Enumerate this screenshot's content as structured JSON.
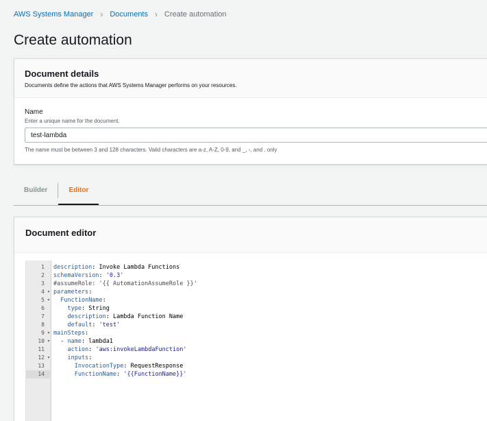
{
  "breadcrumb": {
    "items": [
      "AWS Systems Manager",
      "Documents",
      "Create automation"
    ]
  },
  "page": {
    "title": "Create automation"
  },
  "details": {
    "title": "Document details",
    "description": "Documents define the actions that AWS Systems Manager performs on your resources.",
    "name_label": "Name",
    "name_description": "Enter a unique name for the document.",
    "name_value": "test-lambda",
    "name_constraint": "The name must be between 3 and 128 characters. Valid characters are a-z, A-Z, 0-9, and _, -, and . only"
  },
  "tabs": [
    {
      "label": "Builder",
      "active": false
    },
    {
      "label": "Editor",
      "active": true
    }
  ],
  "editor": {
    "title": "Document editor",
    "active_line": 14,
    "lines": [
      {
        "num": "1",
        "fold": false,
        "parts": [
          [
            "k",
            "description"
          ],
          [
            "plain",
            ": Invoke Lambda Functions"
          ]
        ]
      },
      {
        "num": "2",
        "fold": false,
        "parts": [
          [
            "k",
            "schemaVersion"
          ],
          [
            "plain",
            ": "
          ],
          [
            "s",
            "'0.3'"
          ]
        ]
      },
      {
        "num": "3",
        "fold": false,
        "parts": [
          [
            "c",
            "#assumeRole: '{{ AutomationAssumeRole }}'"
          ]
        ]
      },
      {
        "num": "4",
        "fold": true,
        "parts": [
          [
            "k",
            "parameters"
          ],
          [
            "plain",
            ":"
          ]
        ]
      },
      {
        "num": "5",
        "fold": true,
        "parts": [
          [
            "plain",
            "  "
          ],
          [
            "k",
            "FunctionName"
          ],
          [
            "plain",
            ":"
          ]
        ]
      },
      {
        "num": "6",
        "fold": false,
        "parts": [
          [
            "plain",
            "    "
          ],
          [
            "k",
            "type"
          ],
          [
            "plain",
            ": String"
          ]
        ]
      },
      {
        "num": "7",
        "fold": false,
        "parts": [
          [
            "plain",
            "    "
          ],
          [
            "k",
            "description"
          ],
          [
            "plain",
            ": Lambda Function Name"
          ]
        ]
      },
      {
        "num": "8",
        "fold": false,
        "parts": [
          [
            "plain",
            "    "
          ],
          [
            "k",
            "default"
          ],
          [
            "plain",
            ": "
          ],
          [
            "s",
            "'test'"
          ]
        ]
      },
      {
        "num": "9",
        "fold": true,
        "parts": [
          [
            "k",
            "mainSteps"
          ],
          [
            "plain",
            ":"
          ]
        ]
      },
      {
        "num": "10",
        "fold": true,
        "parts": [
          [
            "plain",
            "  - "
          ],
          [
            "k",
            "name"
          ],
          [
            "plain",
            ": lambda1"
          ]
        ]
      },
      {
        "num": "11",
        "fold": false,
        "parts": [
          [
            "plain",
            "    "
          ],
          [
            "k",
            "action"
          ],
          [
            "plain",
            ": "
          ],
          [
            "s",
            "'aws:invokeLambdaFunction'"
          ]
        ]
      },
      {
        "num": "12",
        "fold": true,
        "parts": [
          [
            "plain",
            "    "
          ],
          [
            "k",
            "inputs"
          ],
          [
            "plain",
            ":"
          ]
        ]
      },
      {
        "num": "13",
        "fold": false,
        "parts": [
          [
            "plain",
            "      "
          ],
          [
            "k",
            "InvocationType"
          ],
          [
            "plain",
            ": RequestResponse"
          ]
        ]
      },
      {
        "num": "14",
        "fold": false,
        "parts": [
          [
            "plain",
            "      "
          ],
          [
            "k",
            "FunctionName"
          ],
          [
            "plain",
            ": "
          ],
          [
            "s",
            "'{{FunctionName}}'"
          ]
        ]
      }
    ]
  },
  "colors": {
    "link": "#0073bb",
    "active_tab": "#ec7211",
    "code_key": "#1f5fa8",
    "code_string": "#1a1aa6"
  },
  "icons": {
    "breadcrumb_separator": "chevron-right-icon",
    "fold_marker": "fold-arrow-icon"
  }
}
